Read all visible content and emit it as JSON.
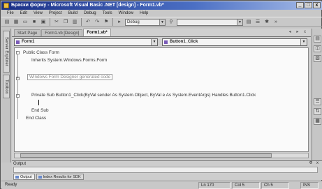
{
  "window": {
    "title": "Браски форму - Microsoft Visual Basic .NET [design] - Form1.vb*",
    "controls": [
      "_",
      "□",
      "x"
    ]
  },
  "menu": [
    "File",
    "Edit",
    "View",
    "Project",
    "Build",
    "Debug",
    "Tools",
    "Window",
    "Help"
  ],
  "toolbar": {
    "config": "Debug",
    "icons": [
      "new-project-icon",
      "add-item-icon",
      "open-icon",
      "save-icon",
      "save-all-icon",
      "cut-icon",
      "copy-icon",
      "paste-icon",
      "undo-icon",
      "redo-icon",
      "bookmark-icon",
      "start-icon",
      "find-icon",
      "solution-explorer-icon",
      "properties-icon",
      "toolbox-icon"
    ]
  },
  "left_toolbox": [
    "Server Explorer",
    "Toolbox"
  ],
  "tabs": [
    {
      "label": "Start Page",
      "active": false
    },
    {
      "label": "Form1.vb [Design]",
      "active": false
    },
    {
      "label": "Form1.vb*",
      "active": true
    }
  ],
  "tab_controls": "◂ ▸ x",
  "class_dropdown": "Form1",
  "method_dropdown": "Button1_Click",
  "code_lines": [
    "Public Class Form",
    "Inherits System.Windows.Forms.Form",
    "Windows Form Designer generated code",
    "Private Sub Button1_Click(ByVal sender As System.Object, ByVal e As System.EventArgs) Handles Button1.Click",
    "End Sub",
    "End Class"
  ],
  "output": {
    "title": "Output",
    "controls": "Ф x",
    "tabs": [
      "Output",
      "Index Results for SDK"
    ]
  },
  "status": {
    "ready": "Ready",
    "line": "Ln 170",
    "col": "Col 5",
    "ch": "Ch 5",
    "mode": "INS"
  }
}
